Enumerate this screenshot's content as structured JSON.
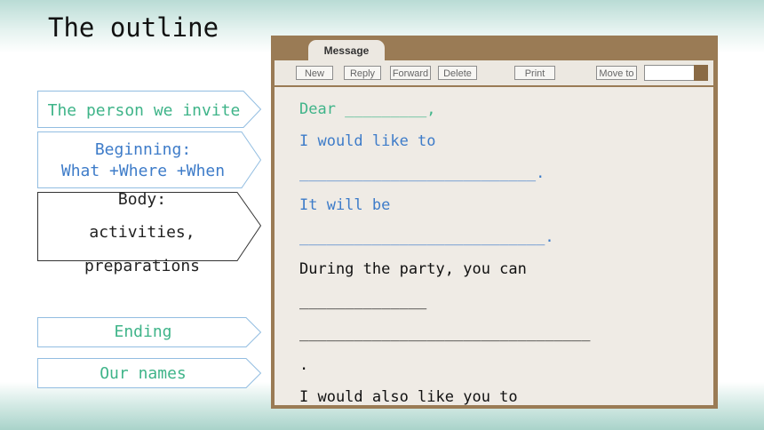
{
  "page": {
    "title": "The outline"
  },
  "outline": {
    "items": [
      {
        "label": "The person we invite"
      },
      {
        "line1": "Beginning:",
        "line2": "What +Where +When"
      },
      {
        "line1": "Body:",
        "line2": "activities,",
        "line3": "preparations"
      },
      {
        "label": "Ending"
      },
      {
        "label": "Our names"
      }
    ]
  },
  "window": {
    "tab_label": "Message",
    "toolbar": {
      "new_label": "New",
      "reply_label": "Reply",
      "forward_label": "Forward",
      "delete_label": "Delete",
      "print_label": "Print",
      "moveto_label": "Move to"
    },
    "body": {
      "line1": "Dear _________,",
      "line2": "I would like to",
      "line3": "__________________________.",
      "line4": "It will be",
      "line5": "___________________________.",
      "line6": "During the party, you can",
      "line7": "______________",
      "line8": "________________________________",
      "line9": ".",
      "line10": "I would also like you to"
    }
  },
  "colors": {
    "green_text": "#3fb489",
    "blue_text": "#3e7cc9",
    "frame_brown": "#9a7b55",
    "outline_border": "#92bde1"
  }
}
